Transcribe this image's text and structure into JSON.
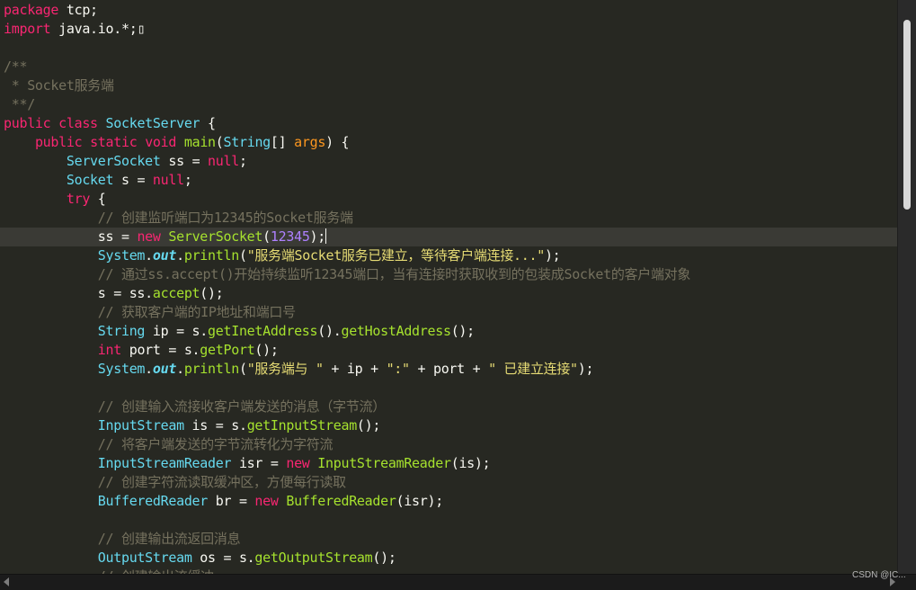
{
  "editor": {
    "theme_colors": {
      "background": "#272822",
      "current_line": "#3a3a35",
      "keyword": "#f92672",
      "type": "#66d9ef",
      "string": "#e6db74",
      "number": "#ae81ff",
      "function": "#a6e22e",
      "comment": "#75715e",
      "parameter": "#fd971f",
      "plain": "#f8f8f2"
    },
    "current_line_index": 12,
    "lines": [
      [
        [
          "kw",
          "package"
        ],
        [
          "plain",
          " tcp;"
        ]
      ],
      [
        [
          "kw",
          "import"
        ],
        [
          "plain",
          " java.io.*;"
        ],
        [
          "gt",
          "▯"
        ]
      ],
      [],
      [
        [
          "cm",
          "/**"
        ]
      ],
      [
        [
          "cm",
          " * Socket服务端"
        ]
      ],
      [
        [
          "cm",
          " **/"
        ]
      ],
      [
        [
          "kw",
          "public"
        ],
        [
          "plain",
          " "
        ],
        [
          "kw",
          "class"
        ],
        [
          "plain",
          " "
        ],
        [
          "type",
          "SocketServer"
        ],
        [
          "plain",
          " {"
        ]
      ],
      [
        [
          "plain",
          "    "
        ],
        [
          "kw",
          "public"
        ],
        [
          "plain",
          " "
        ],
        [
          "kw",
          "static"
        ],
        [
          "plain",
          " "
        ],
        [
          "kw",
          "void"
        ],
        [
          "plain",
          " "
        ],
        [
          "fn",
          "main"
        ],
        [
          "plain",
          "("
        ],
        [
          "type",
          "String"
        ],
        [
          "plain",
          "[] "
        ],
        [
          "param",
          "args"
        ],
        [
          "plain",
          ") {"
        ]
      ],
      [
        [
          "plain",
          "        "
        ],
        [
          "type",
          "ServerSocket"
        ],
        [
          "plain",
          " ss = "
        ],
        [
          "kw",
          "null"
        ],
        [
          "plain",
          ";"
        ]
      ],
      [
        [
          "plain",
          "        "
        ],
        [
          "type",
          "Socket"
        ],
        [
          "plain",
          " s = "
        ],
        [
          "kw",
          "null"
        ],
        [
          "plain",
          ";"
        ]
      ],
      [
        [
          "plain",
          "        "
        ],
        [
          "kw",
          "try"
        ],
        [
          "plain",
          " {"
        ]
      ],
      [
        [
          "plain",
          "            "
        ],
        [
          "cm",
          "// 创建监听端口为12345的Socket服务端"
        ]
      ],
      [
        [
          "plain",
          "            ss = "
        ],
        [
          "kw",
          "new"
        ],
        [
          "plain",
          " "
        ],
        [
          "fn",
          "ServerSocket"
        ],
        [
          "plain",
          "("
        ],
        [
          "num",
          "12345"
        ],
        [
          "plain",
          ");"
        ]
      ],
      [
        [
          "plain",
          "            "
        ],
        [
          "type",
          "System"
        ],
        [
          "plain",
          "."
        ],
        [
          "static",
          "out"
        ],
        [
          "plain",
          "."
        ],
        [
          "fn",
          "println"
        ],
        [
          "plain",
          "("
        ],
        [
          "str",
          "\"服务端Socket服务已建立，等待客户端连接...\""
        ],
        [
          "plain",
          ");"
        ]
      ],
      [
        [
          "plain",
          "            "
        ],
        [
          "cm",
          "// 通过ss.accept()开始持续监听12345端口，当有连接时获取收到的包装成Socket的客户端对象"
        ]
      ],
      [
        [
          "plain",
          "            s = ss."
        ],
        [
          "fn",
          "accept"
        ],
        [
          "plain",
          "();"
        ]
      ],
      [
        [
          "plain",
          "            "
        ],
        [
          "cm",
          "// 获取客户端的IP地址和端口号"
        ]
      ],
      [
        [
          "plain",
          "            "
        ],
        [
          "type",
          "String"
        ],
        [
          "plain",
          " ip = s."
        ],
        [
          "fn",
          "getInetAddress"
        ],
        [
          "plain",
          "()."
        ],
        [
          "fn",
          "getHostAddress"
        ],
        [
          "plain",
          "();"
        ]
      ],
      [
        [
          "plain",
          "            "
        ],
        [
          "kw",
          "int"
        ],
        [
          "plain",
          " port = s."
        ],
        [
          "fn",
          "getPort"
        ],
        [
          "plain",
          "();"
        ]
      ],
      [
        [
          "plain",
          "            "
        ],
        [
          "type",
          "System"
        ],
        [
          "plain",
          "."
        ],
        [
          "static",
          "out"
        ],
        [
          "plain",
          "."
        ],
        [
          "fn",
          "println"
        ],
        [
          "plain",
          "("
        ],
        [
          "str",
          "\"服务端与 \""
        ],
        [
          "plain",
          " + ip + "
        ],
        [
          "str",
          "\":\""
        ],
        [
          "plain",
          " + port + "
        ],
        [
          "str",
          "\" 已建立连接\""
        ],
        [
          "plain",
          ");"
        ]
      ],
      [],
      [
        [
          "plain",
          "            "
        ],
        [
          "cm",
          "// 创建输入流接收客户端发送的消息（字节流）"
        ]
      ],
      [
        [
          "plain",
          "            "
        ],
        [
          "type",
          "InputStream"
        ],
        [
          "plain",
          " is = s."
        ],
        [
          "fn",
          "getInputStream"
        ],
        [
          "plain",
          "();"
        ]
      ],
      [
        [
          "plain",
          "            "
        ],
        [
          "cm",
          "// 将客户端发送的字节流转化为字符流"
        ]
      ],
      [
        [
          "plain",
          "            "
        ],
        [
          "type",
          "InputStreamReader"
        ],
        [
          "plain",
          " isr = "
        ],
        [
          "kw",
          "new"
        ],
        [
          "plain",
          " "
        ],
        [
          "fn",
          "InputStreamReader"
        ],
        [
          "plain",
          "(is);"
        ]
      ],
      [
        [
          "plain",
          "            "
        ],
        [
          "cm",
          "// 创建字符流读取缓冲区，方便每行读取"
        ]
      ],
      [
        [
          "plain",
          "            "
        ],
        [
          "type",
          "BufferedReader"
        ],
        [
          "plain",
          " br = "
        ],
        [
          "kw",
          "new"
        ],
        [
          "plain",
          " "
        ],
        [
          "fn",
          "BufferedReader"
        ],
        [
          "plain",
          "(isr);"
        ]
      ],
      [],
      [
        [
          "plain",
          "            "
        ],
        [
          "cm",
          "// 创建输出流返回消息"
        ]
      ],
      [
        [
          "plain",
          "            "
        ],
        [
          "type",
          "OutputStream"
        ],
        [
          "plain",
          " os = s."
        ],
        [
          "fn",
          "getOutputStream"
        ],
        [
          "plain",
          "();"
        ]
      ],
      [
        [
          "plain",
          "            "
        ],
        [
          "cm",
          "// 创建输出流缓冲"
        ]
      ]
    ]
  },
  "scrollbar": {
    "vertical_position": 0.04,
    "vertical_visible_fraction": 0.33
  },
  "watermark": "CSDN @IC..."
}
